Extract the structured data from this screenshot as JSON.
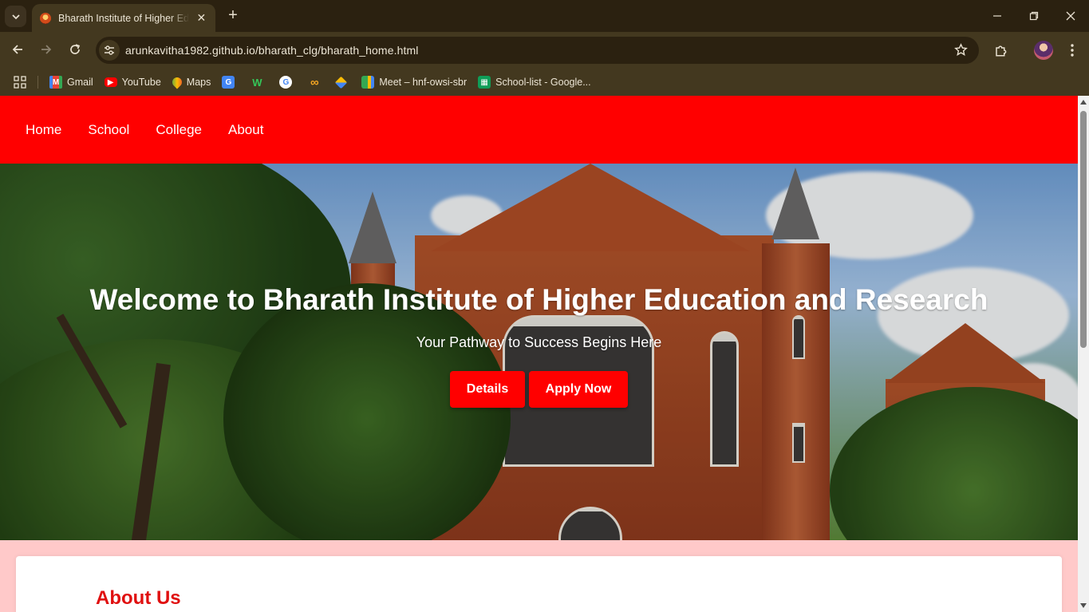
{
  "browser": {
    "tab_title": "Bharath Institute of Higher Education and Research",
    "url": "arunkavitha1982.github.io/bharath_clg/bharath_home.html",
    "bookmarks": [
      {
        "label": "Gmail",
        "icon": "gmail-icon"
      },
      {
        "label": "YouTube",
        "icon": "youtube-icon"
      },
      {
        "label": "Maps",
        "icon": "maps-icon"
      },
      {
        "label": "",
        "icon": "translate-icon"
      },
      {
        "label": "",
        "icon": "w-icon"
      },
      {
        "label": "",
        "icon": "google-icon"
      },
      {
        "label": "",
        "icon": "infinity-icon"
      },
      {
        "label": "",
        "icon": "drive-like-icon"
      },
      {
        "label": "Meet – hnf-owsi-sbr",
        "icon": "meet-icon"
      },
      {
        "label": "School-list - Google...",
        "icon": "sheets-icon"
      }
    ]
  },
  "site": {
    "nav": [
      "Home",
      "School",
      "College",
      "About"
    ],
    "hero_title": "Welcome to Bharath Institute of Higher Education and Research",
    "hero_subtitle": "Your Pathway to Success Begins Here",
    "buttons": {
      "details": "Details",
      "apply": "Apply Now"
    },
    "about_title": "About Us",
    "colors": {
      "brand_red": "#ff0000",
      "page_bg": "#ffc9c9",
      "heading_red": "#e01010"
    }
  }
}
